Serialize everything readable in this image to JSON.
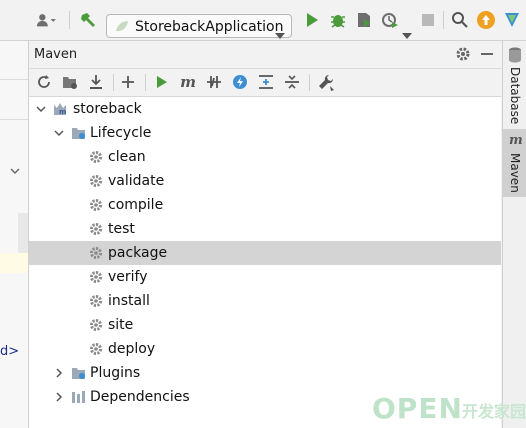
{
  "toolbar": {
    "run_config": "StorebackApplication",
    "icons": [
      "user-icon",
      "hammer-icon",
      "run-icon",
      "debug-icon",
      "coverage-icon",
      "profile-icon",
      "stop-icon",
      "search-icon",
      "update-icon"
    ]
  },
  "maven_panel": {
    "title": "Maven",
    "tree": {
      "project": "storeback",
      "lifecycle": "Lifecycle",
      "phases": [
        "clean",
        "validate",
        "compile",
        "test",
        "package",
        "verify",
        "install",
        "site",
        "deploy"
      ],
      "selected_phase": "package",
      "plugins": "Plugins",
      "dependencies": "Dependencies"
    }
  },
  "right_strip": {
    "tabs": [
      "Database",
      "Maven"
    ],
    "maven_tab_icon_letter": "m"
  },
  "gutter": {
    "fragment": "d>"
  },
  "watermark": {
    "brand": "OPEN",
    "suffix": "开发家园"
  },
  "colors": {
    "run_green": "#4a9b3a",
    "accent_blue": "#3d8fd1",
    "selection": "#d4d4d4",
    "update_orange": "#f0a020"
  }
}
